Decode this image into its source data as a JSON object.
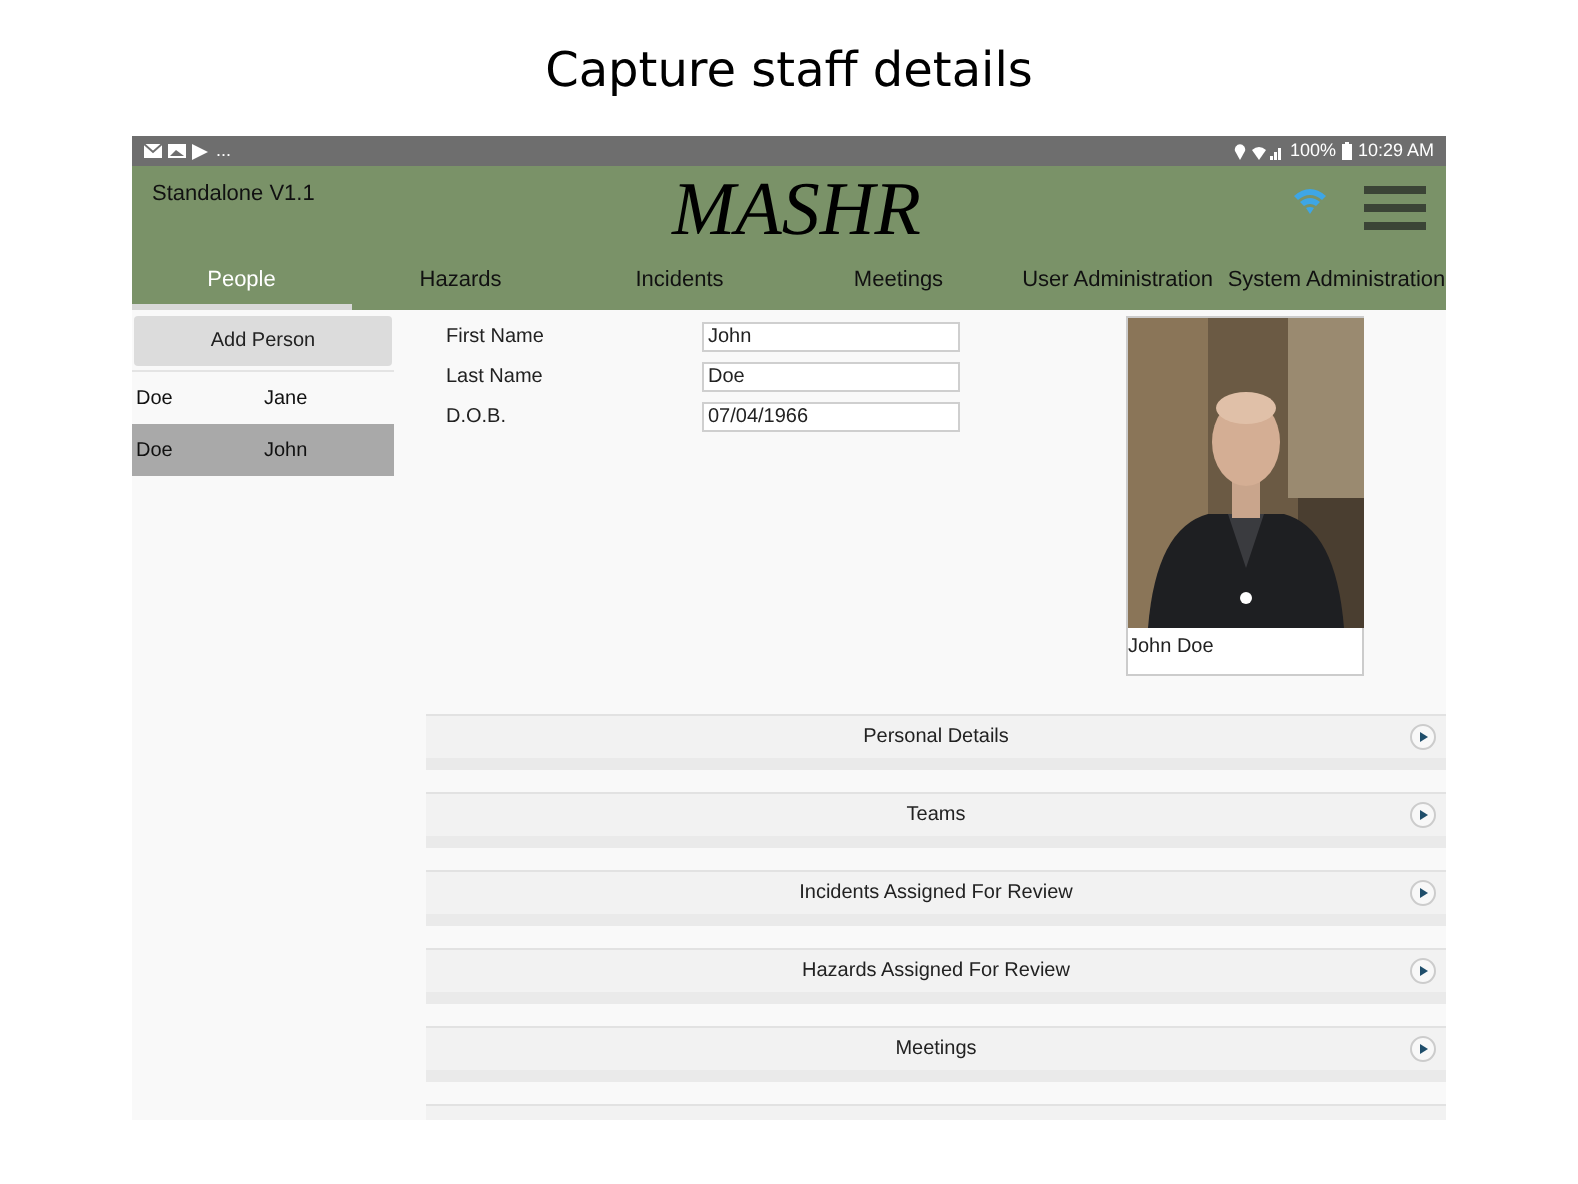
{
  "caption": "Capture staff details",
  "status_bar": {
    "more": "...",
    "battery": "100%",
    "time": "10:29 AM"
  },
  "header": {
    "version": "Standalone V1.1",
    "logo": "MASHR"
  },
  "tabs": [
    {
      "label": "People",
      "selected": true
    },
    {
      "label": "Hazards",
      "selected": false
    },
    {
      "label": "Incidents",
      "selected": false
    },
    {
      "label": "Meetings",
      "selected": false
    },
    {
      "label": "User Administration",
      "selected": false
    },
    {
      "label": "System Administration",
      "selected": false
    }
  ],
  "sidebar": {
    "add_button": "Add Person",
    "people": [
      {
        "last_name": "Doe",
        "first_name": "Jane",
        "selected": false
      },
      {
        "last_name": "Doe",
        "first_name": "John",
        "selected": true
      }
    ]
  },
  "form": {
    "fields": [
      {
        "label": "First Name",
        "value": "John"
      },
      {
        "label": "Last Name",
        "value": "Doe"
      },
      {
        "label": "D.O.B.",
        "value": "07/04/1966"
      }
    ]
  },
  "photo": {
    "kind": "picture",
    "caption": "John Doe"
  },
  "sections": [
    {
      "title": "Personal Details"
    },
    {
      "title": "Teams"
    },
    {
      "title": "Incidents Assigned For Review"
    },
    {
      "title": "Hazards Assigned For Review"
    },
    {
      "title": "Meetings"
    }
  ]
}
